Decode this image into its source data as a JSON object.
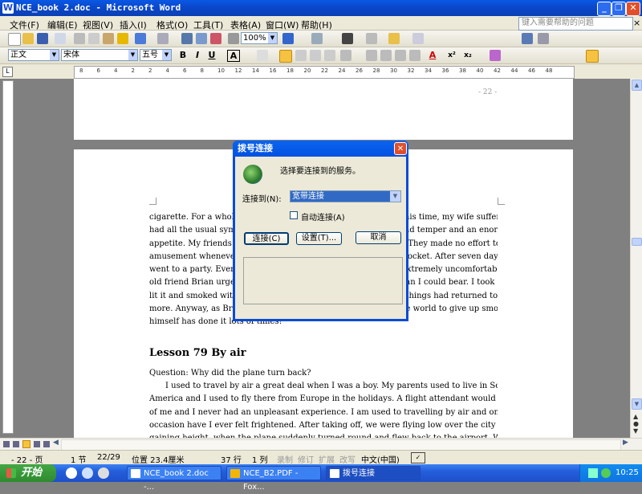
{
  "window": {
    "title": "NCE_book 2.doc - Microsoft Word",
    "min": "_",
    "max": "❐",
    "close": "✕"
  },
  "menu": {
    "items": [
      "文件(F)",
      "编辑(E)",
      "视图(V)",
      "插入(I)",
      "格式(O)",
      "工具(T)",
      "表格(A)",
      "窗口(W)",
      "帮助(H)"
    ],
    "help_placeholder": "键入需要帮助的问题",
    "doc_close": "×"
  },
  "toolbar": {
    "zoom": "100%",
    "style": "正文",
    "font": "宋体",
    "size": "五号",
    "bold": "B",
    "italic": "I",
    "underline": "U",
    "border_char": "A",
    "font_color": "A",
    "superscript": "x²",
    "subscript": "x₂"
  },
  "ruler": {
    "ticks": [
      "8",
      "6",
      "4",
      "2",
      "2",
      "4",
      "6",
      "8",
      "10",
      "12",
      "14",
      "16",
      "18",
      "20",
      "22",
      "24",
      "26",
      "28",
      "30",
      "32",
      "34",
      "36",
      "38",
      "40",
      "42",
      "44",
      "46",
      "48"
    ]
  },
  "document": {
    "page_number": "- 22 -",
    "paragraph_lines": [
      "cigarette. For a whole week I did not smoke at all and during this time, my wife suffered terribly. I",
      "had all the usual symptoms of someone giving up smoking: a bad temper and an enormous",
      "appetite. My friends kept on offering me cigarettes and cigars. They made no effort to hide their",
      "amusement whenever I produced a packet of sweets from my pocket. After seven days of this I",
      "went to a party. Everybody around me was smoking and I felt extremely uncomfortable. When my",
      "old friend Brian urged me to accept a cigarette, it was more than I could bear. I took one guiltily,",
      "lit it and smoked with satisfaction. My wife was delighted that things had returned to normal once",
      "more. Anyway, as Brian pointed out, it is the easiest thing in the world to give up smoking. He",
      "himself has done it lots of times!"
    ],
    "lesson_heading": "Lesson 79    By air",
    "question": "Question: Why did the plane turn back?",
    "body_lines": [
      "I used to travel by air a great deal when I was a boy. My parents used to live in South",
      "America and I used to fly there from Europe in the holidays. A flight attendant would take charge",
      "of me and I never had an unpleasant experience. I am used to travelling by air and only on one",
      "occasion have I ever felt frightened. After taking off, we were flying low over the city and slowly",
      "gaining height, when the plane suddenly turned round and flew back to the airport. While we were"
    ]
  },
  "dialog": {
    "title": "拨号连接",
    "close": "✕",
    "prompt": "选择要连接到的服务。",
    "connect_to_label": "连接到(N):",
    "connect_to_value": "宽带连接",
    "auto_connect_label": "自动连接(A)",
    "connect_button": "连接(C)",
    "settings_button": "设置(T)...",
    "cancel_button": "取消"
  },
  "status": {
    "page": "- 22 - 页",
    "section": "1 节",
    "page_count": "22/29",
    "position": "位置 23.4厘米",
    "line": "37 行",
    "column": "1 列",
    "rec": "录制",
    "trk": "修订",
    "ext": "扩展",
    "ovr": "改写",
    "language": "中文(中国)"
  },
  "taskbar": {
    "start": "开始",
    "tasks": [
      "NCE_book 2.doc -...",
      "NCE_B2.PDF - Fox...",
      "拨号连接"
    ],
    "clock": "10:25"
  },
  "colors": {
    "title_blue": "#0a46c8",
    "dialog_blue": "#0a4ad8",
    "start_green": "#2f8a2f",
    "highlight": "#316ac5"
  }
}
